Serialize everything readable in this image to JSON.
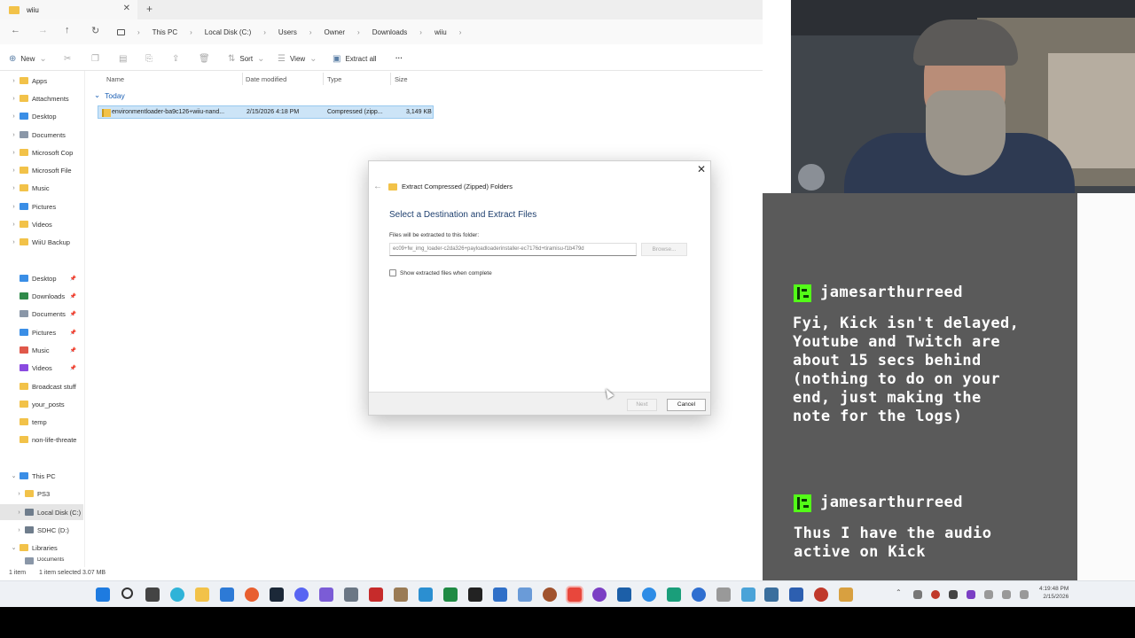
{
  "explorer": {
    "tab_title": "wiiu",
    "breadcrumbs": [
      "This PC",
      "Local Disk (C:)",
      "Users",
      "Owner",
      "Downloads",
      "wiiu"
    ],
    "toolbar": {
      "new": "New",
      "sort": "Sort",
      "view": "View",
      "extract_all": "Extract all",
      "more": "···"
    },
    "nav_quick": [
      "Apps",
      "Attachments",
      "Desktop",
      "Documents",
      "Microsoft Cop",
      "Microsoft File",
      "Music",
      "Pictures",
      "Videos",
      "WiiU Backup"
    ],
    "nav_pinned": [
      "Desktop",
      "Downloads",
      "Documents",
      "Pictures",
      "Music",
      "Videos",
      "Broadcast stuff",
      "your_posts",
      "temp",
      "non-life-threate"
    ],
    "nav_pc": {
      "this_pc": "This PC",
      "items": [
        "PS3",
        "Local Disk (C:)",
        "SDHC (D:)"
      ],
      "libraries": "Libraries",
      "libraries_child": "Documents"
    },
    "columns": {
      "name": "Name",
      "date": "Date modified",
      "type": "Type",
      "size": "Size"
    },
    "group_label": "Today",
    "file": {
      "name": "environmentloader-ba9c126+wiiu-nand...",
      "date": "2/15/2026 4:18 PM",
      "type": "Compressed (zipp...",
      "size": "3,149 KB"
    },
    "status": {
      "count": "1 item",
      "selected": "1 item selected  3.07 MB"
    }
  },
  "dialog": {
    "title": "Extract Compressed (Zipped) Folders",
    "heading": "Select a Destination and Extract Files",
    "dest_label": "Files will be extracted to this folder:",
    "dest_path": "ec09+fw_img_loader-c2da326+payloadloaderinstaller-ec7176d+tiramisu-f1b479d",
    "browse": "Browse...",
    "show_files": "Show extracted files when complete",
    "next": "Next",
    "cancel": "Cancel"
  },
  "chat": [
    {
      "user": "jamesarthurreed",
      "text": "Fyi, Kick isn't delayed,\nYoutube and Twitch are\nabout 15 secs behind\n(nothing to do on your\nend, just making the\nnote for the logs)"
    },
    {
      "user": "jamesarthurreed",
      "text": "Thus I have the audio\nactive on Kick"
    }
  ],
  "taskbar": {
    "time": "4:19:48 PM",
    "date": "2/15/2026"
  },
  "colors": {
    "kick_green": "#53fc18",
    "chat_bg": "#5a5a5a",
    "selection": "#cce4f7"
  }
}
